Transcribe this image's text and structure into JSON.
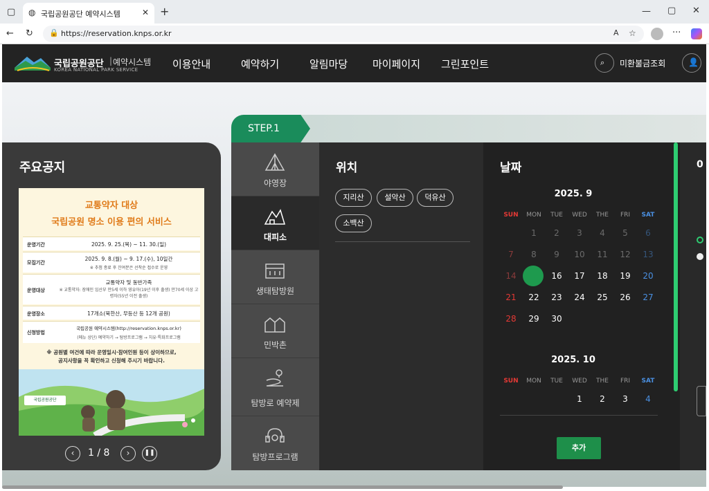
{
  "browser": {
    "tab_title": "국립공원공단 예약시스템",
    "url": "https://reservation.knps.or.kr"
  },
  "header": {
    "logo_main": "국립공원공단",
    "logo_sub": "예약시스템",
    "logo_en": "KOREA NATIONAL PARK SERVICE",
    "nav": [
      "이용안내",
      "예약하기",
      "알림마당",
      "마이페이지",
      "그린포인트"
    ],
    "refund_label": "미환불금조회"
  },
  "notice": {
    "title": "주요공지",
    "poster": {
      "line1": "교통약자 대상",
      "line2": "국립공원 명소 이용 편의 서비스",
      "rows": [
        {
          "label": "운영기간",
          "value": "2025. 9. 25.(목) ~ 11. 30.(일)",
          "note": ""
        },
        {
          "label": "모집기간",
          "value": "2025. 9. 8.(월) ~ 9. 17.(수), 10일간",
          "note": "※ 추첨 종료 후 잔여분은 선착순 접수로 운영"
        },
        {
          "label": "운영대상",
          "value": "교통약자 및 동반가족",
          "note": "※ 교통약자: 장애인 임산부 만5세 이하 영유아(19년 이후 출생) 만70세 이상 고령자(55년 이전 출생)"
        },
        {
          "label": "운영장소",
          "value": "17개소(북한산, 무등산 등 12개 공원)",
          "note": ""
        },
        {
          "label": "신청방법",
          "value": "국립공원 예약시스템(http://reservation.knps.or.kr)",
          "note": "(메뉴 상단) 예약하기 → 탐방프로그램 → 치유·특화프로그램"
        }
      ],
      "footnote1": "※ 공원별 여건에 따라 운영일시·참여인원 등이 상이하므로,",
      "footnote2": "공지사항을 꼭 확인하고 신청해 주시기 바랍니다.",
      "badge": "국립공원공단"
    },
    "pager": "1 / 8"
  },
  "step": {
    "label": "STEP.1",
    "categories": [
      "야영장",
      "대피소",
      "생태탐방원",
      "민박촌",
      "탐방로 예약제",
      "탐방프로그램"
    ],
    "selected_category": "대피소"
  },
  "location": {
    "title": "위치",
    "chips": [
      "지리산",
      "설악산",
      "덕유산",
      "소백산"
    ]
  },
  "date": {
    "title": "날짜",
    "weekdays": [
      "SUN",
      "MON",
      "TUE",
      "WED",
      "THE",
      "FRI",
      "SAT"
    ],
    "month1": {
      "label": "2025. 9",
      "selected": "15"
    },
    "month2": {
      "label": "2025. 10"
    },
    "add_label": "추가"
  },
  "right": {
    "letter": "0"
  }
}
